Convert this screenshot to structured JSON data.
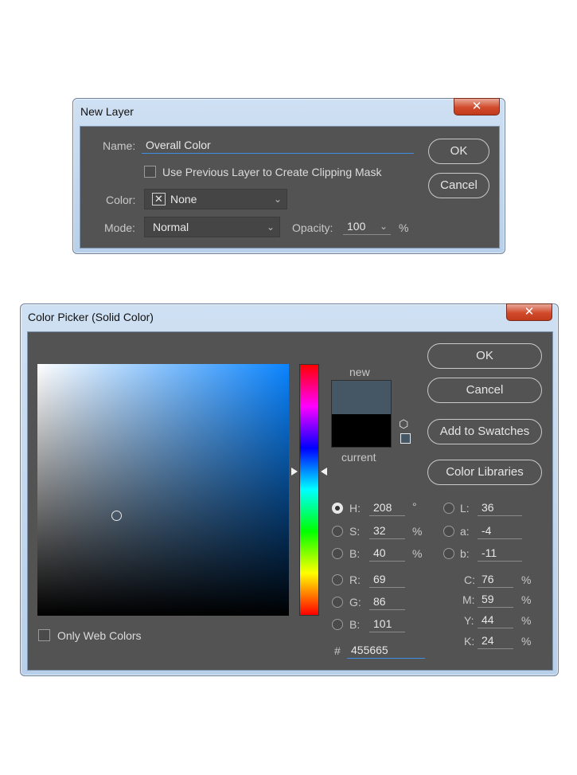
{
  "new_layer": {
    "title": "New Layer",
    "close_glyph": "✕",
    "name_label": "Name:",
    "name_value": "Overall Color",
    "clipping_label": "Use Previous Layer to Create Clipping Mask",
    "clipping_checked": false,
    "color_label": "Color:",
    "color_value": "None",
    "mode_label": "Mode:",
    "mode_value": "Normal",
    "opacity_label": "Opacity:",
    "opacity_value": "100",
    "opacity_unit": "%",
    "ok_label": "OK",
    "cancel_label": "Cancel"
  },
  "color_picker": {
    "title": "Color Picker (Solid Color)",
    "close_glyph": "✕",
    "new_label": "new",
    "current_label": "current",
    "new_color": "#455665",
    "current_color": "#000000",
    "hue_color": "#0a84ff",
    "ok_label": "OK",
    "cancel_label": "Cancel",
    "add_swatches_label": "Add to Swatches",
    "color_libraries_label": "Color Libraries",
    "only_web_label": "Only Web Colors",
    "fields": {
      "H": {
        "label": "H:",
        "value": "208",
        "unit": "°"
      },
      "S": {
        "label": "S:",
        "value": "32",
        "unit": "%"
      },
      "Bv": {
        "label": "B:",
        "value": "40",
        "unit": "%"
      },
      "R": {
        "label": "R:",
        "value": "69"
      },
      "G": {
        "label": "G:",
        "value": "86"
      },
      "Bc": {
        "label": "B:",
        "value": "101"
      },
      "L": {
        "label": "L:",
        "value": "36"
      },
      "a": {
        "label": "a:",
        "value": "-4"
      },
      "b": {
        "label": "b:",
        "value": "-11"
      },
      "C": {
        "label": "C:",
        "value": "76",
        "unit": "%"
      },
      "M": {
        "label": "M:",
        "value": "59",
        "unit": "%"
      },
      "Y": {
        "label": "Y:",
        "value": "44",
        "unit": "%"
      },
      "K": {
        "label": "K:",
        "value": "24",
        "unit": "%"
      }
    },
    "hex_label": "#",
    "hex_value": "455665"
  }
}
